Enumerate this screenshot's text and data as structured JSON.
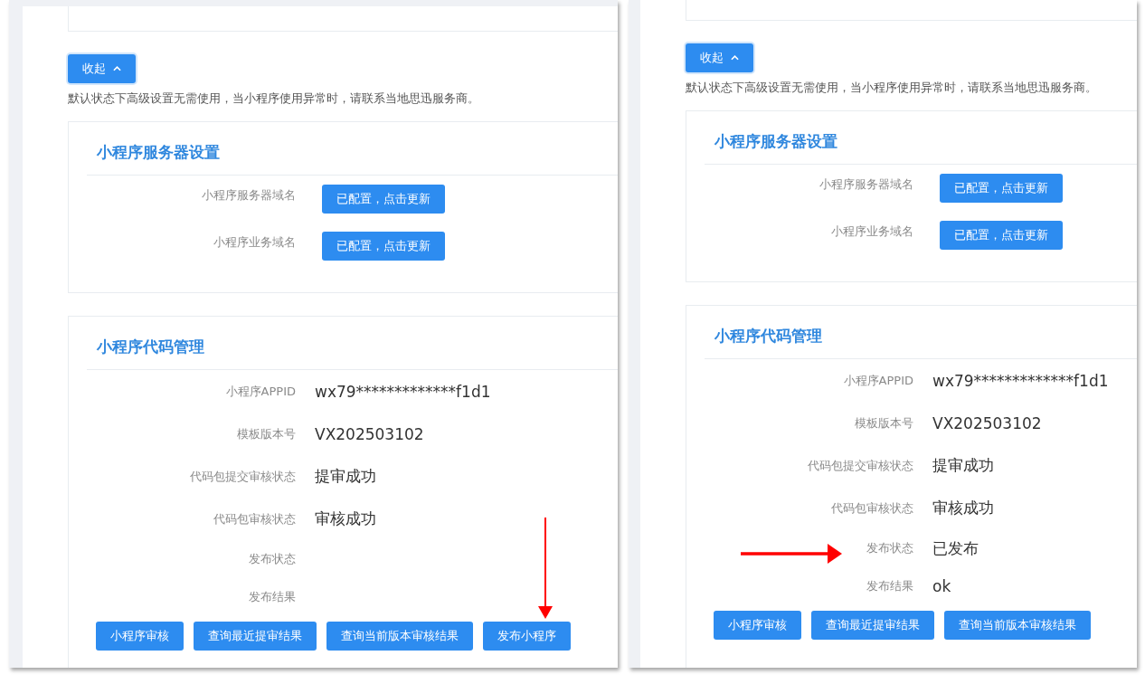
{
  "panels": [
    {
      "collapse_button": "收起",
      "note": "默认状态下高级设置无需使用，当小程序使用异常时，请联系当地思迅服务商。",
      "server_settings": {
        "title": "小程序服务器设置",
        "rows": [
          {
            "label": "小程序服务器域名",
            "button": "已配置，点击更新"
          },
          {
            "label": "小程序业务域名",
            "button": "已配置，点击更新"
          }
        ]
      },
      "code_management": {
        "title": "小程序代码管理",
        "fields": [
          {
            "label": "小程序APPID",
            "value": "wx79*************f1d1"
          },
          {
            "label": "模板版本号",
            "value": "VX202503102"
          },
          {
            "label": "代码包提交审核状态",
            "value": "提审成功"
          },
          {
            "label": "代码包审核状态",
            "value": "审核成功"
          },
          {
            "label": "发布状态"
          },
          {
            "label": "发布结果"
          }
        ],
        "buttons": [
          "小程序审核",
          "查询最近提审结果",
          "查询当前版本审核结果",
          "发布小程序"
        ]
      },
      "annotation": {
        "kind": "arrow-down"
      }
    },
    {
      "collapse_button": "收起",
      "note": "默认状态下高级设置无需使用，当小程序使用异常时，请联系当地思迅服务商。",
      "server_settings": {
        "title": "小程序服务器设置",
        "rows": [
          {
            "label": "小程序服务器域名",
            "button": "已配置，点击更新"
          },
          {
            "label": "小程序业务域名",
            "button": "已配置，点击更新"
          }
        ]
      },
      "code_management": {
        "title": "小程序代码管理",
        "fields": [
          {
            "label": "小程序APPID",
            "value": "wx79*************f1d1"
          },
          {
            "label": "模板版本号",
            "value": "VX202503102"
          },
          {
            "label": "代码包提交审核状态",
            "value": "提审成功"
          },
          {
            "label": "代码包审核状态",
            "value": "审核成功"
          },
          {
            "label": "发布状态",
            "value": "已发布"
          },
          {
            "label": "发布结果",
            "value": "ok"
          }
        ],
        "buttons": [
          "小程序审核",
          "查询最近提审结果",
          "查询当前版本审核结果"
        ]
      },
      "annotation": {
        "kind": "arrow-right"
      }
    }
  ]
}
